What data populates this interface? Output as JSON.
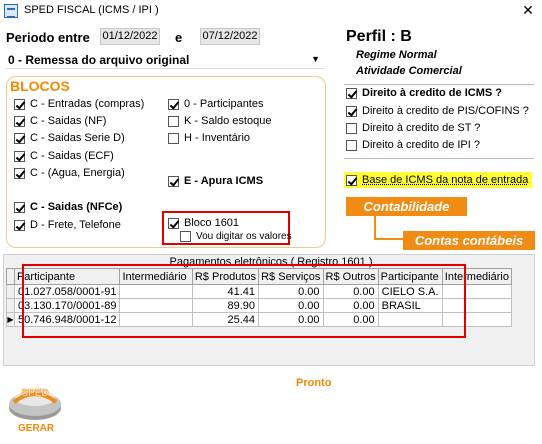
{
  "window": {
    "title": "SPED FISCAL (ICMS / IPI )",
    "close": "✕"
  },
  "periodo": {
    "label": "Periodo entre",
    "start": "01/12/2022",
    "conj": "e",
    "end": "07/12/2022"
  },
  "finalidade": {
    "value": "0 - Remessa do arquivo original"
  },
  "blocos": {
    "title": "BLOCOS",
    "items": [
      {
        "label": "C - Entradas (compras)",
        "checked": true
      },
      {
        "label": "C - Saidas (NF)",
        "checked": true
      },
      {
        "label": "C - Saidas Serie D)",
        "checked": true
      },
      {
        "label": "C - Saidas (ECF)",
        "checked": true
      },
      {
        "label": "C - (Agua, Energia)",
        "checked": true
      },
      {
        "label": "0 - Participantes",
        "checked": true
      },
      {
        "label": "K - Saldo estoque",
        "checked": false
      },
      {
        "label": "H - Inventário",
        "checked": false
      },
      {
        "label": "E - Apura ICMS",
        "checked": true
      },
      {
        "label": "C - Saidas (NFCe)",
        "checked": true
      },
      {
        "label": "D - Frete, Telefone",
        "checked": true
      },
      {
        "label": "Bloco 1601",
        "checked": true
      },
      {
        "label": "Vou digitar os valores",
        "checked": false
      }
    ]
  },
  "perfil": {
    "title": "Perfil : B",
    "regime": "Regime Normal",
    "atividade": "Atividade Comercial"
  },
  "creditos": [
    {
      "label": "Direito à credito de ICMS ?",
      "checked": true
    },
    {
      "label": "Direito à credito de PIS/COFINS ?",
      "checked": true
    },
    {
      "label": "Direito à credito de ST ?",
      "checked": false
    },
    {
      "label": "Direito à credito de IPI ?",
      "checked": false
    },
    {
      "label": "Base de ICMS da nota de entrada",
      "checked": true
    }
  ],
  "buttons": {
    "contabilidade": "Contabilidade",
    "contas": "Contas contábeis"
  },
  "grid": {
    "caption": "Pagamentos eletrônicos ( Registro 1601 )",
    "columns": [
      "Participante",
      "Intermediário",
      "R$ Produtos",
      "R$ Serviços",
      "R$ Outros",
      "Participante",
      "Intermediário"
    ],
    "rows": [
      [
        "01.027.058/0001-91",
        "",
        "41.41",
        "0.00",
        "0.00",
        "CIELO S.A.",
        ""
      ],
      [
        "03.130.170/0001-89",
        "",
        "89.90",
        "0.00",
        "0.00",
        "BRASIL",
        ""
      ],
      [
        "50.746.948/0001-12",
        "",
        "25.44",
        "0.00",
        "0.00",
        "",
        ""
      ]
    ],
    "current_row_marker": "▶"
  },
  "status": "Pronto",
  "logo": {
    "text": "SPED",
    "button": "GERAR"
  },
  "colors": {
    "accent": "#f08c14",
    "highlight": "#ffff33",
    "annotation": "#e00000"
  }
}
